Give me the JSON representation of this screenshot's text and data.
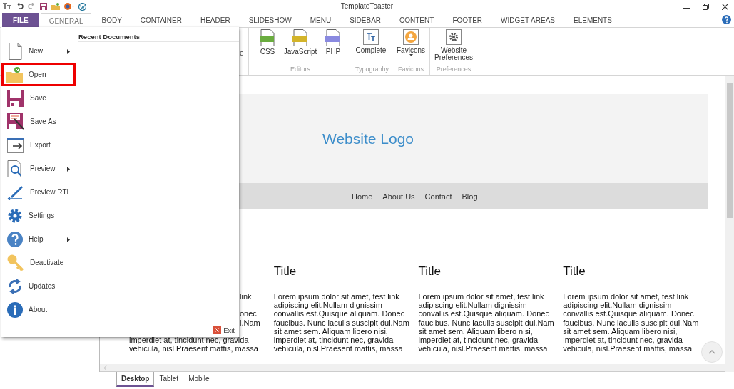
{
  "window": {
    "title": "TemplateToaster"
  },
  "tabs": [
    {
      "label": "FILE",
      "selected": false,
      "kind": "file"
    },
    {
      "label": "GENERAL",
      "selected": true,
      "kind": "tab"
    },
    {
      "label": "BODY",
      "selected": false,
      "kind": "tab"
    },
    {
      "label": "CONTAINER",
      "selected": false,
      "kind": "tab"
    },
    {
      "label": "HEADER",
      "selected": false,
      "kind": "tab"
    },
    {
      "label": "SLIDESHOW",
      "selected": false,
      "kind": "tab"
    },
    {
      "label": "MENU",
      "selected": false,
      "kind": "tab"
    },
    {
      "label": "SIDEBAR",
      "selected": false,
      "kind": "tab"
    },
    {
      "label": "CONTENT",
      "selected": false,
      "kind": "tab"
    },
    {
      "label": "FOOTER",
      "selected": false,
      "kind": "tab"
    },
    {
      "label": "WIDGET AREAS",
      "selected": false,
      "kind": "tab"
    },
    {
      "label": "ELEMENTS",
      "selected": false,
      "kind": "tab"
    }
  ],
  "ribbon": {
    "cut_label": "e",
    "groups": [
      {
        "label": "Editors",
        "buttons": [
          {
            "label": "CSS",
            "dropdown": false
          },
          {
            "label": "JavaScript",
            "dropdown": false
          },
          {
            "label": "PHP",
            "dropdown": false
          }
        ]
      },
      {
        "label": "Typography",
        "buttons": [
          {
            "label": "Complete",
            "dropdown": false
          }
        ]
      },
      {
        "label": "Favicons",
        "buttons": [
          {
            "label": "Favicons",
            "dropdown": true
          }
        ]
      },
      {
        "label": "Preferences",
        "buttons": [
          {
            "label": "Website Preferences",
            "dropdown": false
          }
        ]
      }
    ]
  },
  "file_menu": {
    "items": [
      {
        "label": "New",
        "submenu": true,
        "selected": false
      },
      {
        "label": "Open",
        "submenu": false,
        "selected": true
      },
      {
        "label": "Save",
        "submenu": false,
        "selected": false
      },
      {
        "label": "Save As",
        "submenu": false,
        "selected": false
      },
      {
        "label": "Export",
        "submenu": false,
        "selected": false
      },
      {
        "label": "Preview",
        "submenu": true,
        "selected": false
      },
      {
        "label": "Preview RTL",
        "submenu": false,
        "selected": false
      },
      {
        "label": "Settings",
        "submenu": false,
        "selected": false
      },
      {
        "label": "Help",
        "submenu": true,
        "selected": false
      },
      {
        "label": "Deactivate",
        "submenu": false,
        "selected": false
      },
      {
        "label": "Updates",
        "submenu": false,
        "selected": false
      },
      {
        "label": "About",
        "submenu": false,
        "selected": false
      }
    ],
    "recent_heading": "Recent Documents",
    "exit": "Exit"
  },
  "preview": {
    "logo": "Website Logo",
    "nav": [
      "Home",
      "About Us",
      "Contact",
      "Blog"
    ],
    "columns": [
      {
        "lines": [
          {
            "kind": "tail",
            "text": "link"
          },
          {
            "kind": "blank"
          },
          {
            "kind": "tail",
            "text": "onec"
          },
          {
            "kind": "tail",
            "text": "i.Nam"
          },
          {
            "kind": "blank"
          },
          {
            "kind": "full",
            "text": "imperdiet at, tincidunt nec, gravida"
          },
          {
            "kind": "full",
            "text": "vehicula, nisl.Praesent mattis, massa"
          }
        ]
      },
      {
        "title": "Title",
        "text": "Lorem ipsum dolor sit amet, test link adipiscing elit.Nullam dignissim convallis est.Quisque aliquam. Donec faucibus. Nunc iaculis suscipit dui.Nam sit amet sem. Aliquam libero nisi, imperdiet at, tincidunt nec, gravida vehicula, nisl.Praesent mattis, massa"
      },
      {
        "title": "Title",
        "text": "Lorem ipsum dolor sit amet, test link adipiscing elit.Nullam dignissim convallis est.Quisque aliquam. Donec faucibus. Nunc iaculis suscipit dui.Nam sit amet sem. Aliquam libero nisi, imperdiet at, tincidunt nec, gravida vehicula, nisl.Praesent mattis, massa"
      },
      {
        "title": "Title",
        "text": "Lorem ipsum dolor sit amet, test link adipiscing elit.Nullam dignissim convallis est.Quisque aliquam. Donec faucibus. Nunc iaculis suscipit dui.Nam sit amet sem. Aliquam libero nisi, imperdiet at, tincidunt nec, gravida vehicula, nisl.Praesent mattis, massa"
      }
    ]
  },
  "device_tabs": [
    {
      "label": "Desktop",
      "selected": true
    },
    {
      "label": "Tablet",
      "selected": false
    },
    {
      "label": "Mobile",
      "selected": false
    }
  ]
}
